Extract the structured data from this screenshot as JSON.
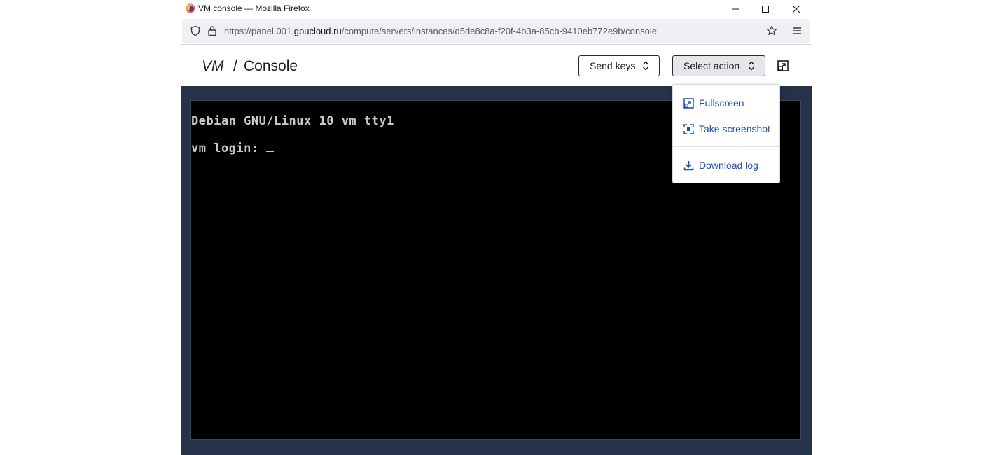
{
  "browser": {
    "window_title": "VM console — Mozilla Firefox",
    "url_prefix": "https://panel.001.",
    "url_host": "gpucloud.ru",
    "url_path": "/compute/servers/instances/d5de8c8a-f20f-4b3a-85cb-9410eb772e9b/console"
  },
  "header": {
    "breadcrumb_parent": "VM",
    "breadcrumb_separator": "/",
    "page_title": "Console",
    "send_keys_label": "Send keys",
    "select_action_label": "Select action"
  },
  "console": {
    "line1": "Debian GNU/Linux 10 vm tty1",
    "line2": "vm login: "
  },
  "action_menu": {
    "items": [
      {
        "label": "Fullscreen",
        "icon": "fullscreen-icon"
      },
      {
        "label": "Take screenshot",
        "icon": "screenshot-icon"
      },
      {
        "label": "Download log",
        "icon": "download-icon"
      }
    ]
  },
  "colors": {
    "console_frame": "#26314a",
    "terminal_bg": "#000000",
    "terminal_text": "#c8c8c8",
    "menu_accent": "#1f4fb3"
  }
}
